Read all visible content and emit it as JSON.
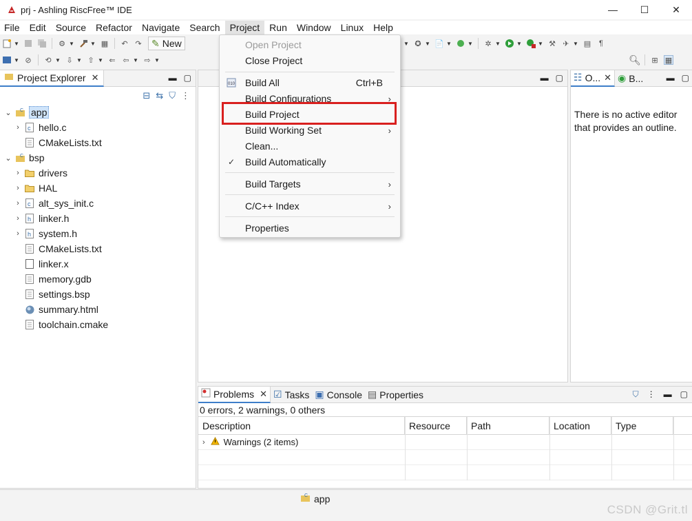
{
  "window": {
    "title": "prj - Ashling RiscFree™ IDE",
    "controls": [
      "—",
      "☐",
      "✕"
    ]
  },
  "menubar": [
    "File",
    "Edit",
    "Source",
    "Refactor",
    "Navigate",
    "Search",
    "Project",
    "Run",
    "Window",
    "Linux",
    "Help"
  ],
  "toolbar": {
    "new_label": "New"
  },
  "project_explorer": {
    "tab_label": "Project Explorer",
    "tree": [
      {
        "label": "app",
        "level": 0,
        "expanded": true,
        "icon": "c-project-icon",
        "selected": true
      },
      {
        "label": "hello.c",
        "level": 1,
        "twisty": true,
        "icon": "c-file-icon"
      },
      {
        "label": "CMakeLists.txt",
        "level": 1,
        "twisty": false,
        "icon": "text-file-icon"
      },
      {
        "label": "bsp",
        "level": 0,
        "expanded": true,
        "icon": "c-project-icon"
      },
      {
        "label": "drivers",
        "level": 1,
        "twisty": true,
        "icon": "folder-icon"
      },
      {
        "label": "HAL",
        "level": 1,
        "twisty": true,
        "icon": "folder-icon"
      },
      {
        "label": "alt_sys_init.c",
        "level": 1,
        "twisty": true,
        "icon": "c-file-icon"
      },
      {
        "label": "linker.h",
        "level": 1,
        "twisty": true,
        "icon": "h-file-icon"
      },
      {
        "label": "system.h",
        "level": 1,
        "twisty": true,
        "icon": "h-file-icon"
      },
      {
        "label": "CMakeLists.txt",
        "level": 1,
        "twisty": false,
        "icon": "text-file-icon"
      },
      {
        "label": "linker.x",
        "level": 1,
        "twisty": false,
        "icon": "blank-file-icon"
      },
      {
        "label": "memory.gdb",
        "level": 1,
        "twisty": false,
        "icon": "text-file-icon"
      },
      {
        "label": "settings.bsp",
        "level": 1,
        "twisty": false,
        "icon": "text-file-icon"
      },
      {
        "label": "summary.html",
        "level": 1,
        "twisty": false,
        "icon": "globe-icon"
      },
      {
        "label": "toolchain.cmake",
        "level": 1,
        "twisty": false,
        "icon": "text-file-icon"
      }
    ]
  },
  "project_menu": {
    "items": [
      {
        "label": "Open Project",
        "disabled": true
      },
      {
        "label": "Close Project"
      },
      {
        "label": "Build All",
        "accelerator": "Ctrl+B",
        "icon": "build-all-icon"
      },
      {
        "label": "Build Configurations",
        "submenu": true
      },
      {
        "label": "Build Project",
        "highlighted": true
      },
      {
        "label": "Build Working Set",
        "submenu": true
      },
      {
        "label": "Clean..."
      },
      {
        "label": "Build Automatically",
        "checked": true
      },
      {
        "label": "Build Targets",
        "submenu": true
      },
      {
        "label": "C/C++ Index",
        "submenu": true
      },
      {
        "label": "Properties"
      }
    ]
  },
  "outline": {
    "tab1": "O...",
    "tab2": "B...",
    "message": "There is no active editor that provides an outline."
  },
  "problems": {
    "tabs": [
      "Problems",
      "Tasks",
      "Console",
      "Properties"
    ],
    "summary": "0 errors, 2 warnings, 0 others",
    "columns": [
      "Description",
      "Resource",
      "Path",
      "Location",
      "Type"
    ],
    "rows": [
      {
        "description": "Warnings (2 items)"
      }
    ]
  },
  "statusbar": {
    "project": "app"
  },
  "watermark": "CSDN @Grit.tl",
  "colors": {
    "highlight_border": "#d9201f",
    "selection": "#cfe4fa",
    "accent": "#3d7ec9"
  }
}
